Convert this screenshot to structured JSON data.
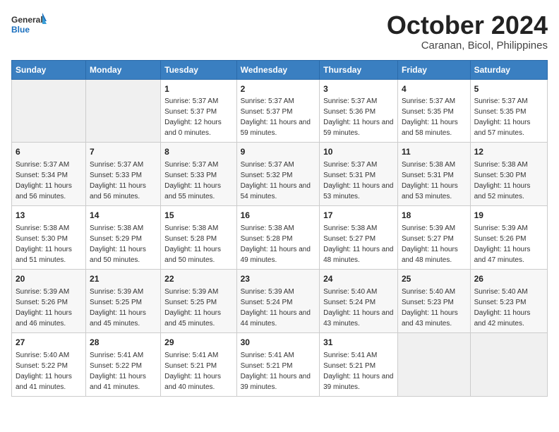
{
  "header": {
    "logo_general": "General",
    "logo_blue": "Blue",
    "month": "October 2024",
    "location": "Caranan, Bicol, Philippines"
  },
  "days_of_week": [
    "Sunday",
    "Monday",
    "Tuesday",
    "Wednesday",
    "Thursday",
    "Friday",
    "Saturday"
  ],
  "weeks": [
    [
      {
        "num": "",
        "sunrise": "",
        "sunset": "",
        "daylight": "",
        "empty": true
      },
      {
        "num": "",
        "sunrise": "",
        "sunset": "",
        "daylight": "",
        "empty": true
      },
      {
        "num": "1",
        "sunrise": "Sunrise: 5:37 AM",
        "sunset": "Sunset: 5:37 PM",
        "daylight": "Daylight: 12 hours and 0 minutes.",
        "empty": false
      },
      {
        "num": "2",
        "sunrise": "Sunrise: 5:37 AM",
        "sunset": "Sunset: 5:37 PM",
        "daylight": "Daylight: 11 hours and 59 minutes.",
        "empty": false
      },
      {
        "num": "3",
        "sunrise": "Sunrise: 5:37 AM",
        "sunset": "Sunset: 5:36 PM",
        "daylight": "Daylight: 11 hours and 59 minutes.",
        "empty": false
      },
      {
        "num": "4",
        "sunrise": "Sunrise: 5:37 AM",
        "sunset": "Sunset: 5:35 PM",
        "daylight": "Daylight: 11 hours and 58 minutes.",
        "empty": false
      },
      {
        "num": "5",
        "sunrise": "Sunrise: 5:37 AM",
        "sunset": "Sunset: 5:35 PM",
        "daylight": "Daylight: 11 hours and 57 minutes.",
        "empty": false
      }
    ],
    [
      {
        "num": "6",
        "sunrise": "Sunrise: 5:37 AM",
        "sunset": "Sunset: 5:34 PM",
        "daylight": "Daylight: 11 hours and 56 minutes.",
        "empty": false
      },
      {
        "num": "7",
        "sunrise": "Sunrise: 5:37 AM",
        "sunset": "Sunset: 5:33 PM",
        "daylight": "Daylight: 11 hours and 56 minutes.",
        "empty": false
      },
      {
        "num": "8",
        "sunrise": "Sunrise: 5:37 AM",
        "sunset": "Sunset: 5:33 PM",
        "daylight": "Daylight: 11 hours and 55 minutes.",
        "empty": false
      },
      {
        "num": "9",
        "sunrise": "Sunrise: 5:37 AM",
        "sunset": "Sunset: 5:32 PM",
        "daylight": "Daylight: 11 hours and 54 minutes.",
        "empty": false
      },
      {
        "num": "10",
        "sunrise": "Sunrise: 5:37 AM",
        "sunset": "Sunset: 5:31 PM",
        "daylight": "Daylight: 11 hours and 53 minutes.",
        "empty": false
      },
      {
        "num": "11",
        "sunrise": "Sunrise: 5:38 AM",
        "sunset": "Sunset: 5:31 PM",
        "daylight": "Daylight: 11 hours and 53 minutes.",
        "empty": false
      },
      {
        "num": "12",
        "sunrise": "Sunrise: 5:38 AM",
        "sunset": "Sunset: 5:30 PM",
        "daylight": "Daylight: 11 hours and 52 minutes.",
        "empty": false
      }
    ],
    [
      {
        "num": "13",
        "sunrise": "Sunrise: 5:38 AM",
        "sunset": "Sunset: 5:30 PM",
        "daylight": "Daylight: 11 hours and 51 minutes.",
        "empty": false
      },
      {
        "num": "14",
        "sunrise": "Sunrise: 5:38 AM",
        "sunset": "Sunset: 5:29 PM",
        "daylight": "Daylight: 11 hours and 50 minutes.",
        "empty": false
      },
      {
        "num": "15",
        "sunrise": "Sunrise: 5:38 AM",
        "sunset": "Sunset: 5:28 PM",
        "daylight": "Daylight: 11 hours and 50 minutes.",
        "empty": false
      },
      {
        "num": "16",
        "sunrise": "Sunrise: 5:38 AM",
        "sunset": "Sunset: 5:28 PM",
        "daylight": "Daylight: 11 hours and 49 minutes.",
        "empty": false
      },
      {
        "num": "17",
        "sunrise": "Sunrise: 5:38 AM",
        "sunset": "Sunset: 5:27 PM",
        "daylight": "Daylight: 11 hours and 48 minutes.",
        "empty": false
      },
      {
        "num": "18",
        "sunrise": "Sunrise: 5:39 AM",
        "sunset": "Sunset: 5:27 PM",
        "daylight": "Daylight: 11 hours and 48 minutes.",
        "empty": false
      },
      {
        "num": "19",
        "sunrise": "Sunrise: 5:39 AM",
        "sunset": "Sunset: 5:26 PM",
        "daylight": "Daylight: 11 hours and 47 minutes.",
        "empty": false
      }
    ],
    [
      {
        "num": "20",
        "sunrise": "Sunrise: 5:39 AM",
        "sunset": "Sunset: 5:26 PM",
        "daylight": "Daylight: 11 hours and 46 minutes.",
        "empty": false
      },
      {
        "num": "21",
        "sunrise": "Sunrise: 5:39 AM",
        "sunset": "Sunset: 5:25 PM",
        "daylight": "Daylight: 11 hours and 45 minutes.",
        "empty": false
      },
      {
        "num": "22",
        "sunrise": "Sunrise: 5:39 AM",
        "sunset": "Sunset: 5:25 PM",
        "daylight": "Daylight: 11 hours and 45 minutes.",
        "empty": false
      },
      {
        "num": "23",
        "sunrise": "Sunrise: 5:39 AM",
        "sunset": "Sunset: 5:24 PM",
        "daylight": "Daylight: 11 hours and 44 minutes.",
        "empty": false
      },
      {
        "num": "24",
        "sunrise": "Sunrise: 5:40 AM",
        "sunset": "Sunset: 5:24 PM",
        "daylight": "Daylight: 11 hours and 43 minutes.",
        "empty": false
      },
      {
        "num": "25",
        "sunrise": "Sunrise: 5:40 AM",
        "sunset": "Sunset: 5:23 PM",
        "daylight": "Daylight: 11 hours and 43 minutes.",
        "empty": false
      },
      {
        "num": "26",
        "sunrise": "Sunrise: 5:40 AM",
        "sunset": "Sunset: 5:23 PM",
        "daylight": "Daylight: 11 hours and 42 minutes.",
        "empty": false
      }
    ],
    [
      {
        "num": "27",
        "sunrise": "Sunrise: 5:40 AM",
        "sunset": "Sunset: 5:22 PM",
        "daylight": "Daylight: 11 hours and 41 minutes.",
        "empty": false
      },
      {
        "num": "28",
        "sunrise": "Sunrise: 5:41 AM",
        "sunset": "Sunset: 5:22 PM",
        "daylight": "Daylight: 11 hours and 41 minutes.",
        "empty": false
      },
      {
        "num": "29",
        "sunrise": "Sunrise: 5:41 AM",
        "sunset": "Sunset: 5:21 PM",
        "daylight": "Daylight: 11 hours and 40 minutes.",
        "empty": false
      },
      {
        "num": "30",
        "sunrise": "Sunrise: 5:41 AM",
        "sunset": "Sunset: 5:21 PM",
        "daylight": "Daylight: 11 hours and 39 minutes.",
        "empty": false
      },
      {
        "num": "31",
        "sunrise": "Sunrise: 5:41 AM",
        "sunset": "Sunset: 5:21 PM",
        "daylight": "Daylight: 11 hours and 39 minutes.",
        "empty": false
      },
      {
        "num": "",
        "sunrise": "",
        "sunset": "",
        "daylight": "",
        "empty": true
      },
      {
        "num": "",
        "sunrise": "",
        "sunset": "",
        "daylight": "",
        "empty": true
      }
    ]
  ]
}
